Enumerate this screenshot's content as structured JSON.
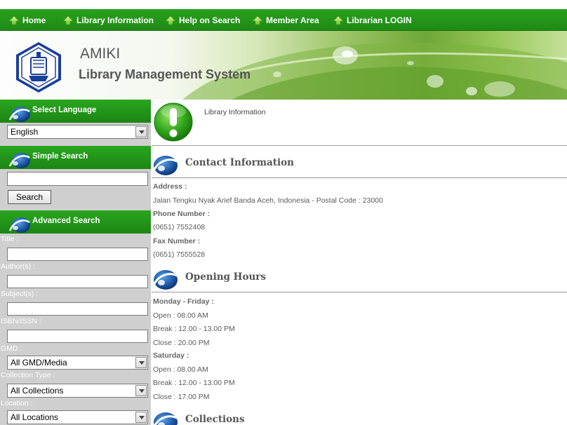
{
  "nav": {
    "items": [
      "Home",
      "Library Information",
      "Help on Search",
      "Member Area",
      "Librarian LOGIN"
    ]
  },
  "header": {
    "title": "AMIKI",
    "subtitle": "Library Management System"
  },
  "sidebar": {
    "language": {
      "heading": "Select Language",
      "selected": "English"
    },
    "simple_search": {
      "heading": "Simple Search",
      "button": "Search",
      "value": ""
    },
    "advanced_search": {
      "heading": "Advanced Search",
      "title_label": "Title :",
      "author_label": "Author(s) :",
      "subject_label": "Subject(s) :",
      "isbn_label": "ISBN/ISSN :",
      "gmd_label": "GMD :",
      "gmd_selected": "All GMD/Media",
      "collection_label": "Collection Type :",
      "collection_selected": "All Collections",
      "location_label": "Location :",
      "location_selected": "All Locations"
    }
  },
  "main": {
    "page_title": "Library Information",
    "contact": {
      "heading": "Contact Information",
      "address_label": "Address :",
      "address": "Jalan Tengku Nyak Arief Banda Aceh, Indonesia - Postal Code : 23000",
      "phone_label": "Phone Number :",
      "phone": "(0651) 7552408",
      "fax_label": "Fax Number :",
      "fax": "(0651) 7555528"
    },
    "hours": {
      "heading": "Opening Hours",
      "weekday_label": "Monday - Friday :",
      "weekday_open": "Open : 08.00 AM",
      "weekday_break": "Break : 12.00 - 13.00 PM",
      "weekday_close": "Close : 20.00 PM",
      "saturday_label": "Saturday :",
      "saturday_open": "Open : 08.00 AM",
      "saturday_break": "Break : 12.00 - 13.00 PM",
      "saturday_close": "Close : 17.00 PM"
    },
    "collections": {
      "heading": "Collections"
    }
  },
  "colors": {
    "nav_green": "#1f8a15",
    "sidebar_grey": "#cfcfcf",
    "text_grey": "#555555"
  }
}
